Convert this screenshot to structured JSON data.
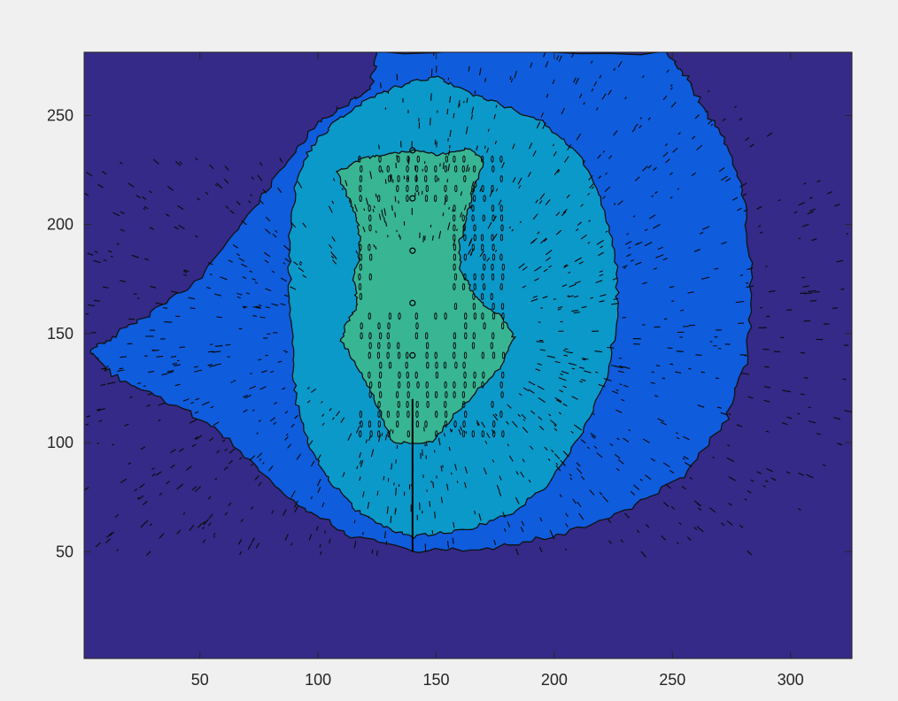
{
  "chart_data": {
    "type": "contourf",
    "title": "",
    "xlabel": "",
    "ylabel": "",
    "xlim": [
      1,
      326
    ],
    "ylim": [
      1,
      279
    ],
    "xticks": [
      50,
      100,
      150,
      200,
      250,
      300
    ],
    "yticks": [
      50,
      100,
      150,
      200,
      250
    ],
    "grid": false,
    "legend": "none",
    "colormap": "parula",
    "level_colors": [
      "#352a87",
      "#0f5cdd",
      "#0a99c9",
      "#38b592"
    ],
    "contour_line_color": "#000000",
    "levels": [
      {
        "name": "level-1-outer",
        "color": "#0f5cdd",
        "polygon": [
          [
            140,
            50
          ],
          [
            175,
            52
          ],
          [
            205,
            58
          ],
          [
            232,
            70
          ],
          [
            255,
            85
          ],
          [
            272,
            108
          ],
          [
            282,
            140
          ],
          [
            284,
            175
          ],
          [
            281,
            210
          ],
          [
            272,
            238
          ],
          [
            262,
            256
          ],
          [
            256,
            268
          ],
          [
            248,
            279
          ],
          [
            125,
            279
          ],
          [
            122,
            262
          ],
          [
            112,
            255
          ],
          [
            100,
            247
          ],
          [
            85,
            226
          ],
          [
            68,
            200
          ],
          [
            50,
            175
          ],
          [
            30,
            160
          ],
          [
            12,
            148
          ],
          [
            4,
            142
          ],
          [
            12,
            132
          ],
          [
            30,
            122
          ],
          [
            55,
            108
          ],
          [
            72,
            90
          ],
          [
            92,
            72
          ],
          [
            112,
            58
          ]
        ]
      },
      {
        "name": "level-2-middle",
        "color": "#0a99c9",
        "polygon": [
          [
            140,
            57
          ],
          [
            163,
            60
          ],
          [
            183,
            68
          ],
          [
            198,
            82
          ],
          [
            212,
            104
          ],
          [
            222,
            130
          ],
          [
            227,
            158
          ],
          [
            226,
            186
          ],
          [
            220,
            212
          ],
          [
            210,
            233
          ],
          [
            195,
            247
          ],
          [
            175,
            256
          ],
          [
            160,
            262
          ],
          [
            150,
            268
          ],
          [
            138,
            265
          ],
          [
            122,
            258
          ],
          [
            108,
            248
          ],
          [
            98,
            237
          ],
          [
            91,
            222
          ],
          [
            88,
            197
          ],
          [
            88,
            170
          ],
          [
            89,
            140
          ],
          [
            91,
            118
          ],
          [
            96,
            98
          ],
          [
            104,
            84
          ],
          [
            115,
            70
          ],
          [
            127,
            62
          ]
        ]
      },
      {
        "name": "level-3-inner",
        "color": "#38b592",
        "polygon": [
          [
            132,
            100
          ],
          [
            148,
            100
          ],
          [
            162,
            118
          ],
          [
            177,
            134
          ],
          [
            183,
            148
          ],
          [
            178,
            158
          ],
          [
            170,
            163
          ],
          [
            165,
            170
          ],
          [
            160,
            180
          ],
          [
            160,
            192
          ],
          [
            163,
            204
          ],
          [
            166,
            215
          ],
          [
            170,
            230
          ],
          [
            164,
            235
          ],
          [
            151,
            232
          ],
          [
            140,
            234
          ],
          [
            128,
            232
          ],
          [
            118,
            230
          ],
          [
            108,
            224
          ],
          [
            113,
            212
          ],
          [
            117,
            200
          ],
          [
            118,
            188
          ],
          [
            115,
            175
          ],
          [
            117,
            163
          ],
          [
            112,
            155
          ],
          [
            110,
            147
          ],
          [
            116,
            136
          ],
          [
            124,
            120
          ]
        ]
      }
    ],
    "markers": [
      [
        140,
        188
      ],
      [
        140,
        164
      ],
      [
        140,
        140
      ],
      [
        140,
        212
      ],
      [
        140,
        234
      ]
    ]
  }
}
